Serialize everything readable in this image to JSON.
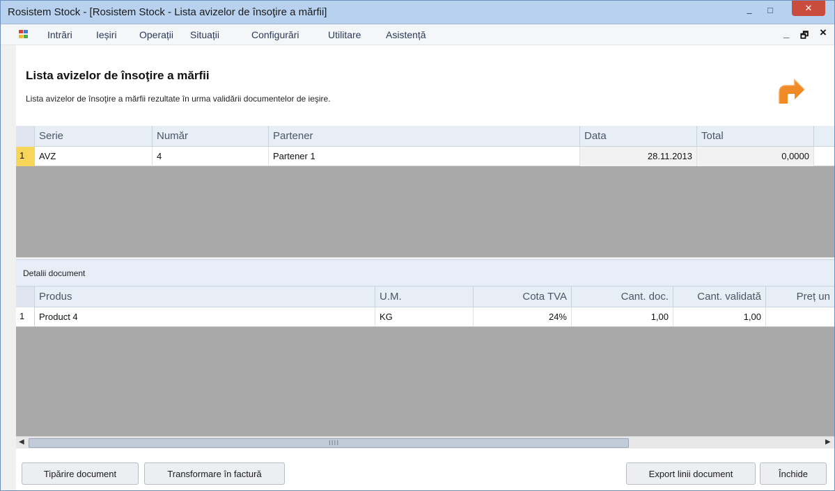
{
  "window": {
    "title": "Rosistem Stock - [Rosistem Stock - Lista avizelor de însoţire a mărfii]",
    "minimize_glyph": "‒",
    "maximize_glyph": "□",
    "close_glyph": "✕"
  },
  "menu": {
    "items": [
      "Intrări",
      "Ieșiri",
      "Operații",
      "Situații",
      "Configurări",
      "Utilitare",
      "Asistență"
    ],
    "mdi_minimize": "_",
    "mdi_restore": "🗗",
    "mdi_close": "×"
  },
  "header": {
    "title": "Lista avizelor de însoţire a mărfii",
    "subtitle": "Lista avizelor de însoţire a mărfii rezultate în urma validării documentelor de ieşire.",
    "back_icon": "arrow-return-icon",
    "accent_color": "#f08a24"
  },
  "top_grid": {
    "columns": [
      "Serie",
      "Număr",
      "Partener",
      "Data",
      "Total"
    ],
    "rows": [
      {
        "index": "1",
        "serie": "AVZ",
        "numar": "4",
        "partener": "Partener 1",
        "data": "28.11.2013",
        "total": "0,0000"
      }
    ]
  },
  "details": {
    "label": "Detalii document",
    "columns": [
      "Produs",
      "U.M.",
      "Cota TVA",
      "Cant. doc.",
      "Cant. validată",
      "Preț un"
    ],
    "rows": [
      {
        "index": "1",
        "produs": "Product 4",
        "um": "KG",
        "cota_tva": "24%",
        "cant_doc": "1,00",
        "cant_validata": "1,00",
        "pret": ""
      }
    ]
  },
  "scrollbar": {
    "left_arrow": "◀",
    "right_arrow": "▶",
    "grip": "IIII"
  },
  "footer": {
    "print_label": "Tipărire document",
    "transform_label": "Transformare în factură",
    "export_label": "Export linii document",
    "close_label": "Închide"
  }
}
